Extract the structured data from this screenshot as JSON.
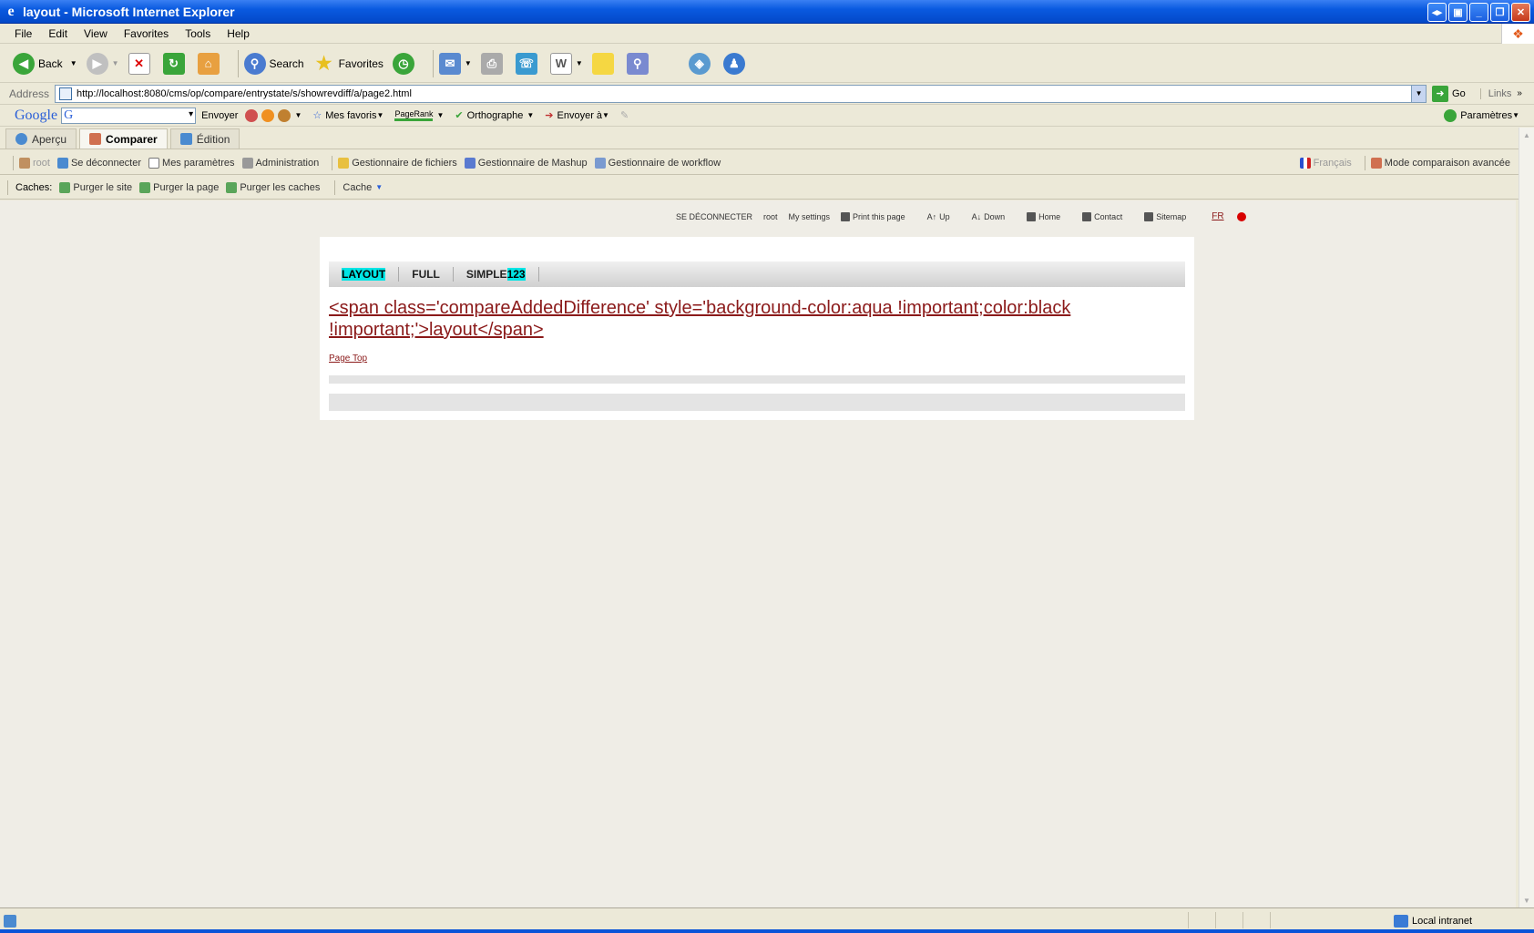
{
  "window": {
    "title": "layout - Microsoft Internet Explorer"
  },
  "menu": [
    "File",
    "Edit",
    "View",
    "Favorites",
    "Tools",
    "Help"
  ],
  "toolbar": {
    "back": "Back",
    "search": "Search",
    "favorites": "Favorites"
  },
  "address": {
    "label": "Address",
    "url": "http://localhost:8080/cms/op/compare/entrystate/s/showrevdiff/a/page2.html",
    "go": "Go",
    "links": "Links"
  },
  "googlebar": {
    "logo": "Google",
    "send": "Envoyer",
    "favs": "Mes favoris",
    "pagerank": "PageRank",
    "spell": "Orthographe",
    "sendto": "Envoyer à",
    "params": "Paramètres"
  },
  "cms_tabs": [
    "Aperçu",
    "Comparer",
    "Édition"
  ],
  "cms_bar": {
    "user": "root",
    "logout": "Se déconnecter",
    "settings": "Mes paramètres",
    "admin": "Administration",
    "files": "Gestionnaire de fichiers",
    "mashup": "Gestionnaire de Mashup",
    "workflow": "Gestionnaire de workflow",
    "lang": "Français",
    "compare_mode": "Mode comparaison avancée"
  },
  "cache_bar": {
    "label": "Caches:",
    "purge_site": "Purger le site",
    "purge_page": "Purger la page",
    "purge_caches": "Purger les caches",
    "cache": "Cache"
  },
  "top_nav": {
    "logout": "SE DÉCONNECTER",
    "user": "root",
    "settings": "My settings",
    "print": "Print this page",
    "up": "Up",
    "down": "Down",
    "home": "Home",
    "contact": "Contact",
    "sitemap": "Sitemap",
    "lang": "FR"
  },
  "page": {
    "nav": {
      "layout": "LAYOUT",
      "full": "FULL",
      "simple": "SIMPLE",
      "simple_num": "123"
    },
    "heading": "<span class='compareAddedDifference' style='background-color:aqua !important;color:black !important;'>layout</span>",
    "page_top": "Page Top"
  },
  "status": {
    "zone": "Local intranet"
  }
}
